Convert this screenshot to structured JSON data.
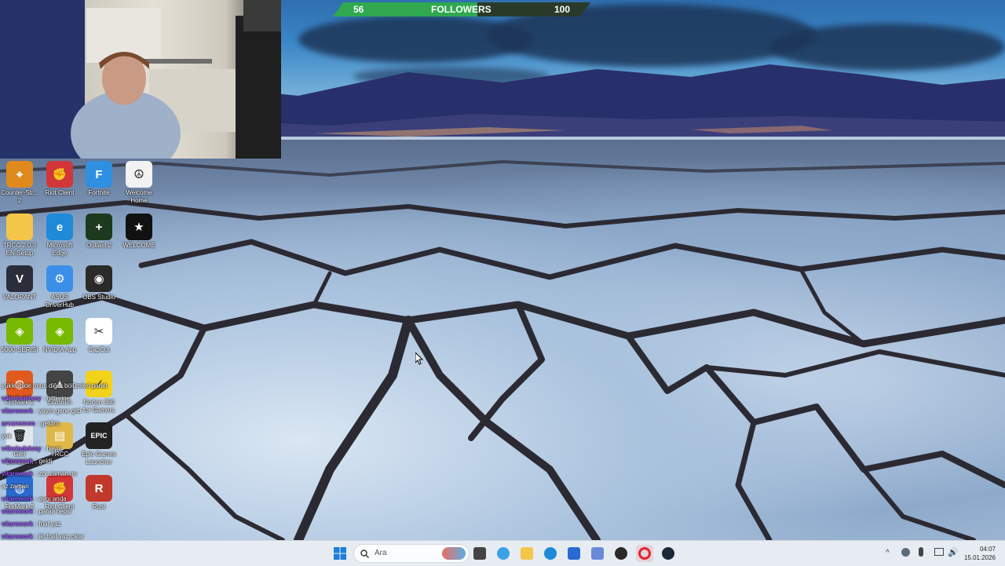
{
  "followers_bar": {
    "current": "56",
    "label": "FOLLOWERS",
    "goal": "100",
    "fill_color": "#2fa84f"
  },
  "desktop_icons": [
    {
      "label": "Counter-Str... 2",
      "icon": "counter-strike-icon",
      "color": "#e08a1e",
      "glyph": "⌖"
    },
    {
      "label": "Riot Client",
      "icon": "riot-client-icon",
      "color": "#d13639",
      "glyph": "✊"
    },
    {
      "label": "Fortnite",
      "icon": "fortnite-icon",
      "color": "#2f8fe0",
      "glyph": "F"
    },
    {
      "label": "Welcome Home",
      "icon": "welcome-home-icon",
      "color": "#f2f2f2",
      "glyph": "☮"
    },
    {
      "label": "TRCC 2.0.3 EN-Setup",
      "icon": "folder-icon",
      "color": "#f3c64a",
      "glyph": ""
    },
    {
      "label": "Microsoft Edge",
      "icon": "edge-icon",
      "color": "#1e8ad8",
      "glyph": "e"
    },
    {
      "label": "Outlast 2",
      "icon": "outlast-icon",
      "color": "#1d3a1f",
      "glyph": "+"
    },
    {
      "label": "WELCOME",
      "icon": "welcome-star-icon",
      "color": "#111111",
      "glyph": "★"
    },
    {
      "label": "VALORANT",
      "icon": "valorant-icon",
      "color": "#2b2d3a",
      "glyph": "V"
    },
    {
      "label": "ASUS DriverHub",
      "icon": "asus-driverhub-icon",
      "color": "#3b8fe8",
      "glyph": "⚙"
    },
    {
      "label": "OBS Studio",
      "icon": "obs-studio-icon",
      "color": "#2a2a2a",
      "glyph": "◉"
    },
    {
      "label": "5000-SERISI",
      "icon": "nvidia-icon",
      "color": "#76b900",
      "glyph": "◈"
    },
    {
      "label": "NVIDIA App",
      "icon": "nvidia-app-icon",
      "color": "#76b900",
      "glyph": "◈"
    },
    {
      "label": "CapCut",
      "icon": "capcut-icon",
      "color": "#ffffff",
      "glyph": "✂"
    },
    {
      "label": "FurMark 2",
      "icon": "furmark-icon",
      "color": "#e05a1e",
      "glyph": "◍"
    },
    {
      "label": "Erzurum",
      "icon": "game-icon",
      "color": "#444444",
      "glyph": "▲"
    },
    {
      "label": "Norton 360 for Gamers",
      "icon": "norton-icon",
      "color": "#f2d21b",
      "glyph": "✓"
    },
    {
      "label": "Geri Dönüşüm",
      "icon": "recycle-bin-icon",
      "color": "#dfe6ee",
      "glyph": "🗑"
    },
    {
      "label": "TRCC",
      "icon": "trcc-icon",
      "color": "#e0b84a",
      "glyph": "▤"
    },
    {
      "label": "Epic Games Launcher",
      "icon": "epic-games-icon",
      "color": "#222222",
      "glyph": "EPIC"
    },
    {
      "label": "FurMark 2",
      "icon": "furmark-2-icon",
      "color": "#2a6ad0",
      "glyph": "◍"
    },
    {
      "label": "Riot Client",
      "icon": "riot-client-2-icon",
      "color": "#d13639",
      "glyph": "✊"
    },
    {
      "label": "Rust",
      "icon": "rust-icon",
      "color": "#c0392b",
      "glyph": "R"
    }
  ],
  "chat": [
    {
      "user": "",
      "user_color": "#ff7a2a",
      "text": "yükle ibide onun diğer bölümleri paralı"
    },
    {
      "user": "v4lerladelvey",
      "user_color": "#9b59ff",
      "text": "gitti yine"
    },
    {
      "user": "vitarework",
      "user_color": "#9b59ff",
      "text": "yayın gene gitti"
    },
    {
      "user": "arcanemon",
      "user_color": "#9b59ff",
      "text": "geldim"
    },
    {
      "user": "",
      "user_color": "#9b59ff",
      "text": "yok"
    },
    {
      "user": "v4lerladelvey",
      "user_color": "#9b59ff",
      "text": "hayır"
    },
    {
      "user": "vitarework",
      "user_color": "#9b59ff",
      "text": "geldi"
    },
    {
      "user": "vitarework",
      "user_color": "#9b59ff",
      "text": "zor zaman mı"
    },
    {
      "user": "",
      "user_color": "#9b59ff",
      "text": "az zaman"
    },
    {
      "user": "vitarework",
      "user_color": "#9b59ff",
      "text": "aynı anda"
    },
    {
      "user": "vitarework",
      "user_color": "#9b59ff",
      "text": "paralı hepsi"
    },
    {
      "user": "vitarework",
      "user_color": "#9b59ff",
      "text": "fnaf yaz"
    },
    {
      "user": "vitarework",
      "user_color": "#9b59ff",
      "text": "iki fnaf yaz çıkar"
    },
    {
      "user": "vitarework",
      "user_color": "#9b59ff",
      "text": "yıldırtık istiyorum ben"
    }
  ],
  "taskbar": {
    "search_placeholder": "Ara",
    "apps": [
      "file-explorer-icon",
      "copilot-icon",
      "folder-icon",
      "edge-icon",
      "store-icon",
      "gem-icon",
      "obs-icon",
      "opera-icon",
      "steam-icon"
    ],
    "time": "04:07",
    "date": "15.01.2026"
  }
}
